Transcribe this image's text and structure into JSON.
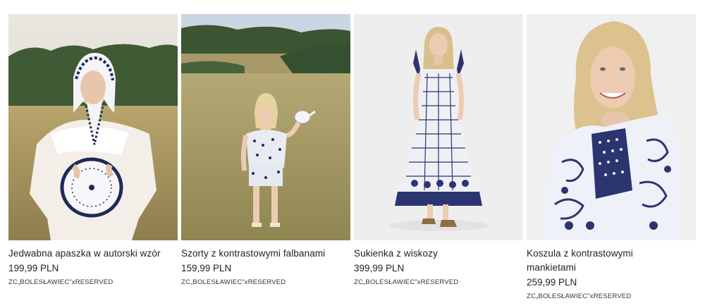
{
  "products": [
    {
      "name": "Jedwabna apaszka w autorski wzór",
      "price": "199,99 PLN",
      "collab": "ZC„BOLESŁAWIEC”xRESERVED",
      "image": "woman-in-field-holding-patterned-plate"
    },
    {
      "name": "Szorty z kontrastowymi falbanami",
      "price": "159,99 PLN",
      "collab": "ZC„BOLESŁAWIEC”xRESERVED",
      "image": "woman-in-meadow-holding-teapot"
    },
    {
      "name": "Sukienka z wiskozy",
      "price": "399,99 PLN",
      "collab": "ZC„BOLESŁAWIEC”xRESERVED",
      "image": "woman-in-patterned-maxi-dress"
    },
    {
      "name": "Koszula z kontrastowymi mankietami",
      "price": "259,99 PLN",
      "collab": "ZC„BOLESŁAWIEC”xRESERVED",
      "image": "smiling-woman-in-patterned-shirt"
    }
  ],
  "colors": {
    "navy": "#1f2a5a",
    "text": "#222222"
  }
}
